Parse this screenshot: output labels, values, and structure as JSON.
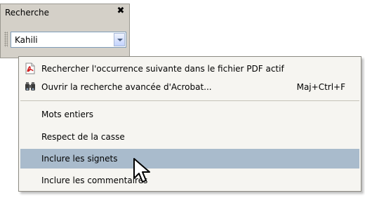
{
  "panel": {
    "title": "Recherche",
    "close_label": "✖"
  },
  "search": {
    "value": "Kahili"
  },
  "menu": {
    "items": [
      {
        "label": "Rechercher l'occurrence suivante dans le fichier PDF actif",
        "icon": "pdf-document-icon",
        "shortcut": ""
      },
      {
        "label": "Ouvrir la recherche avancée d'Acrobat...",
        "icon": "binoculars-icon",
        "shortcut": "Maj+Ctrl+F"
      },
      {
        "label": "Mots entiers"
      },
      {
        "label": "Respect de la casse"
      },
      {
        "label": "Inclure les signets",
        "highlighted": true
      },
      {
        "label": "Inclure les commentaires"
      }
    ]
  },
  "colors": {
    "panel_bg": "#d4d0c8",
    "menu_bg": "#f6f5f1",
    "highlight": "#a9bbcc"
  }
}
